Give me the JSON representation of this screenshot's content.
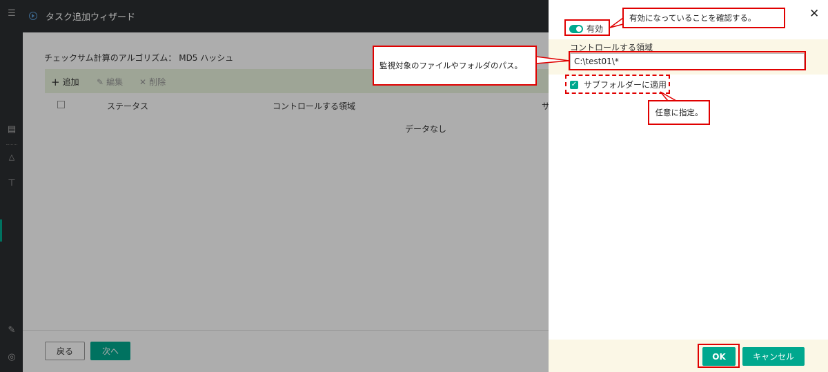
{
  "wizard": {
    "title": "タスク追加ウィザード",
    "algorithm": "チェックサム計算のアルゴリズム：  MD5 ハッシュ",
    "toolbar": {
      "add": "追加",
      "edit": "編集",
      "delete": "削除"
    },
    "columns": [
      "ステータス",
      "コントロールする領域",
      "サ"
    ],
    "empty_text": "データなし",
    "back_label": "戻る",
    "next_label": "次へ"
  },
  "panel": {
    "enabled_label": "有効",
    "enabled": true,
    "field_label": "コントロールする領域",
    "path_value": "C:\\test01\\*",
    "subfolder_label": "サブフォルダーに適用",
    "subfolder_checked": true,
    "ok_label": "OK",
    "cancel_label": "キャンセル"
  },
  "annotations": {
    "enabled_note": "有効になっていることを確認する。",
    "path_note": "監視対象のファイルやフォルダのパス。",
    "subfolder_note": "任意に指定。"
  },
  "colors": {
    "accent": "#00a88e",
    "annotation": "#e00000",
    "header": "#2b2e31"
  }
}
